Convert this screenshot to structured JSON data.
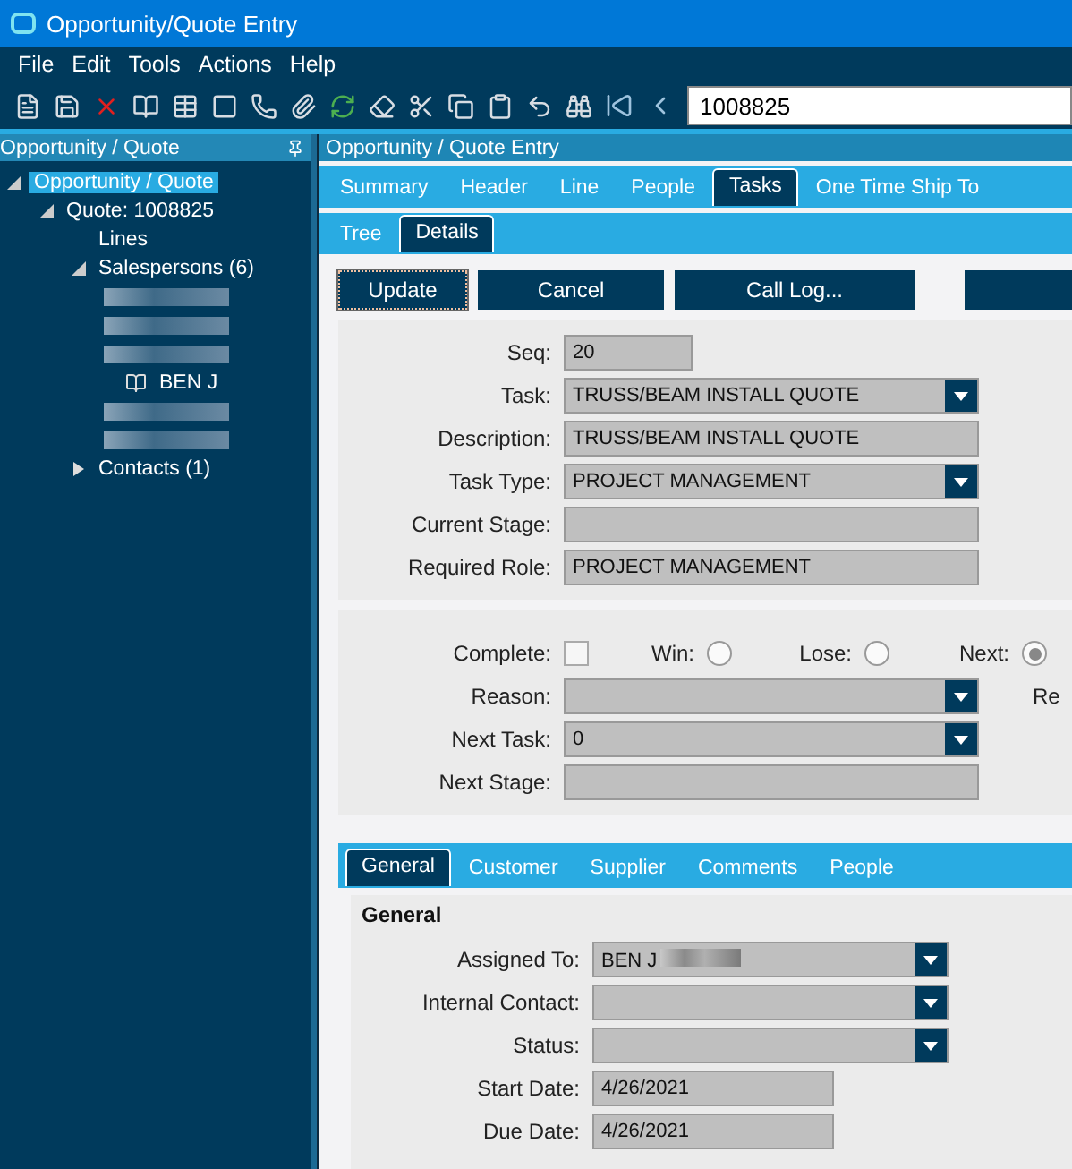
{
  "window": {
    "title": "Opportunity/Quote Entry"
  },
  "menu": [
    "File",
    "Edit",
    "Tools",
    "Actions",
    "Help"
  ],
  "toolbar": {
    "search_value": "1008825"
  },
  "sidebar": {
    "title": "Opportunity / Quote",
    "tree": [
      {
        "label": "Opportunity / Quote",
        "selected": true,
        "expanded": true,
        "children": [
          {
            "label": "Quote: 1008825",
            "selected": false,
            "expanded": true,
            "children": [
              {
                "label": "Lines",
                "selected": false
              },
              {
                "label": "Salespersons (6)",
                "selected": false,
                "expanded": true,
                "children": [
                  {
                    "kind": "redacted"
                  },
                  {
                    "kind": "redacted"
                  },
                  {
                    "kind": "redacted"
                  },
                  {
                    "kind": "named",
                    "label": "BEN J"
                  },
                  {
                    "kind": "redacted"
                  },
                  {
                    "kind": "redacted"
                  }
                ]
              },
              {
                "label": "Contacts (1)",
                "selected": false,
                "expanded": false
              }
            ]
          }
        ]
      }
    ]
  },
  "main": {
    "title": "Opportunity / Quote Entry",
    "tabs": [
      {
        "label": "Summary",
        "selected": false
      },
      {
        "label": "Header",
        "selected": false
      },
      {
        "label": "Line",
        "selected": false
      },
      {
        "label": "People",
        "selected": false
      },
      {
        "label": "Tasks",
        "selected": true
      },
      {
        "label": "One Time Ship To",
        "selected": false
      }
    ],
    "subtabs": [
      {
        "label": "Tree",
        "selected": false
      },
      {
        "label": "Details",
        "selected": true
      }
    ],
    "buttons": [
      "Update",
      "Cancel",
      "Call Log..."
    ],
    "task_fields": [
      {
        "label": "Seq:",
        "kind": "short_text",
        "value": "20"
      },
      {
        "label": "Task:",
        "kind": "dropdown",
        "value": "TRUSS/BEAM INSTALL QUOTE"
      },
      {
        "label": "Description:",
        "kind": "text",
        "value": "TRUSS/BEAM INSTALL QUOTE"
      },
      {
        "label": "Task Type:",
        "kind": "dropdown",
        "value": "PROJECT MANAGEMENT"
      },
      {
        "label": "Current Stage:",
        "kind": "text"
      },
      {
        "label": "Required Role:",
        "kind": "text",
        "value": "PROJECT MANAGEMENT"
      }
    ],
    "completion": {
      "complete_label": "Complete:",
      "complete_checked": false,
      "options": [
        {
          "label": "Win:",
          "selected": false
        },
        {
          "label": "Lose:",
          "selected": false
        },
        {
          "label": "Next:",
          "selected": true
        }
      ],
      "cut_label": "Re"
    },
    "next_fields": [
      {
        "label": "Reason:",
        "kind": "dropdown"
      },
      {
        "label": "Next Task:",
        "kind": "dropdown",
        "value": "0"
      },
      {
        "label": "Next Stage:",
        "kind": "text"
      }
    ],
    "bottom_tabs": [
      {
        "label": "General",
        "selected": true
      },
      {
        "label": "Customer",
        "selected": false
      },
      {
        "label": "Supplier",
        "selected": false
      },
      {
        "label": "Comments",
        "selected": false
      },
      {
        "label": "People",
        "selected": false
      }
    ],
    "general": {
      "heading": "General",
      "fields": [
        {
          "label": "Assigned To:",
          "kind": "dropdown",
          "value": "BEN J",
          "redacted": true
        },
        {
          "label": "Internal Contact:",
          "kind": "dropdown"
        },
        {
          "label": "Status:",
          "kind": "dropdown"
        },
        {
          "label": "Start Date:",
          "kind": "date",
          "value": "4/26/2021"
        },
        {
          "label": "Due Date:",
          "kind": "date",
          "value": "4/26/2021"
        }
      ]
    }
  }
}
